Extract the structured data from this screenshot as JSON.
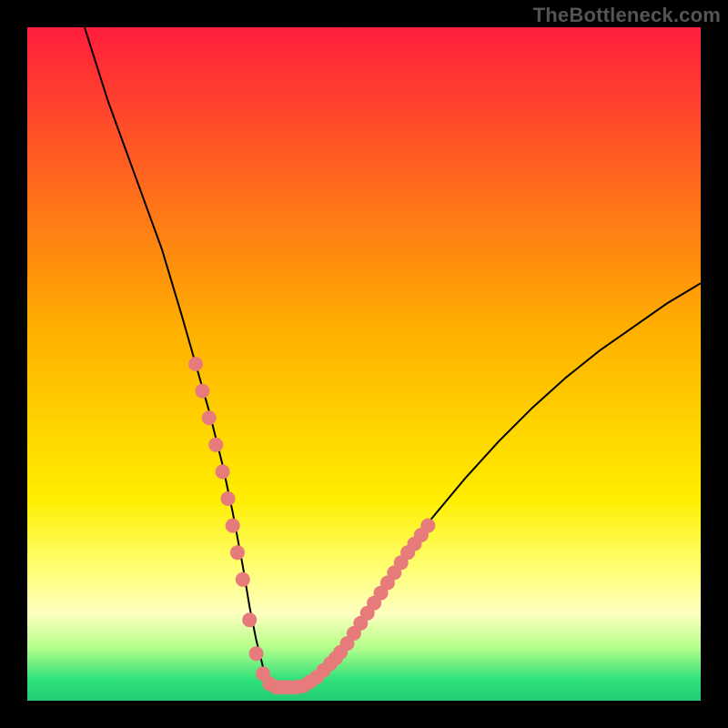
{
  "watermark": "TheBottleneck.com",
  "chart_data": {
    "type": "line",
    "title": "",
    "xlabel": "",
    "ylabel": "",
    "xlim": [
      0,
      100
    ],
    "ylim": [
      0,
      100
    ],
    "background_gradient": {
      "stops": [
        {
          "offset": 0.0,
          "color": "#ff1d3c"
        },
        {
          "offset": 0.45,
          "color": "#ffb000"
        },
        {
          "offset": 0.7,
          "color": "#ffee00"
        },
        {
          "offset": 0.8,
          "color": "#ffff70"
        },
        {
          "offset": 0.87,
          "color": "#ffffc0"
        },
        {
          "offset": 0.92,
          "color": "#b6ff8a"
        },
        {
          "offset": 0.97,
          "color": "#2de07a"
        },
        {
          "offset": 1.0,
          "color": "#24cc74"
        }
      ]
    },
    "series": [
      {
        "name": "bottleneck-curve",
        "color": "#000000",
        "x": [
          8.5,
          12,
          16,
          20,
          23,
          25,
          27,
          29,
          30.5,
          32,
          33,
          34,
          35,
          36,
          37,
          38.5,
          40.5,
          43,
          46,
          50,
          55,
          60,
          65,
          70,
          75,
          80,
          85,
          90,
          95,
          100
        ],
        "y": [
          100,
          89,
          78,
          67,
          57,
          50,
          43,
          35,
          28,
          20,
          14,
          9,
          5,
          2.5,
          2,
          2,
          2,
          3,
          6,
          12,
          20,
          27,
          33,
          38.5,
          43.5,
          48,
          52,
          55.5,
          59,
          62
        ]
      }
    ],
    "scatter_overlay": {
      "name": "highlight-dots",
      "color": "#e77b7b",
      "radius_px": 8,
      "points": [
        {
          "x": 25.0,
          "y": 50.0
        },
        {
          "x": 26.0,
          "y": 46.0
        },
        {
          "x": 27.0,
          "y": 42.0
        },
        {
          "x": 28.0,
          "y": 38.0
        },
        {
          "x": 29.0,
          "y": 34.0
        },
        {
          "x": 29.8,
          "y": 30.0
        },
        {
          "x": 30.5,
          "y": 26.0
        },
        {
          "x": 31.2,
          "y": 22.0
        },
        {
          "x": 32.0,
          "y": 18.0
        },
        {
          "x": 33.0,
          "y": 12.0
        },
        {
          "x": 34.0,
          "y": 7.0
        },
        {
          "x": 35.0,
          "y": 4.0
        },
        {
          "x": 36.0,
          "y": 2.5
        },
        {
          "x": 37.0,
          "y": 2.0
        },
        {
          "x": 38.0,
          "y": 2.0
        },
        {
          "x": 39.0,
          "y": 2.0
        },
        {
          "x": 40.0,
          "y": 2.0
        },
        {
          "x": 41.0,
          "y": 2.2
        },
        {
          "x": 42.0,
          "y": 2.8
        },
        {
          "x": 43.0,
          "y": 3.5
        },
        {
          "x": 44.0,
          "y": 4.5
        },
        {
          "x": 45.0,
          "y": 5.5
        },
        {
          "x": 45.8,
          "y": 6.3
        },
        {
          "x": 46.5,
          "y": 7.2
        },
        {
          "x": 47.5,
          "y": 8.5
        },
        {
          "x": 48.5,
          "y": 10.0
        },
        {
          "x": 49.5,
          "y": 11.5
        },
        {
          "x": 50.5,
          "y": 13.0
        },
        {
          "x": 51.5,
          "y": 14.5
        },
        {
          "x": 52.5,
          "y": 16.0
        },
        {
          "x": 53.5,
          "y": 17.5
        },
        {
          "x": 54.5,
          "y": 19.0
        },
        {
          "x": 55.5,
          "y": 20.5
        },
        {
          "x": 56.5,
          "y": 22.0
        },
        {
          "x": 57.5,
          "y": 23.3
        },
        {
          "x": 58.5,
          "y": 24.6
        },
        {
          "x": 59.5,
          "y": 26.0
        }
      ]
    }
  }
}
